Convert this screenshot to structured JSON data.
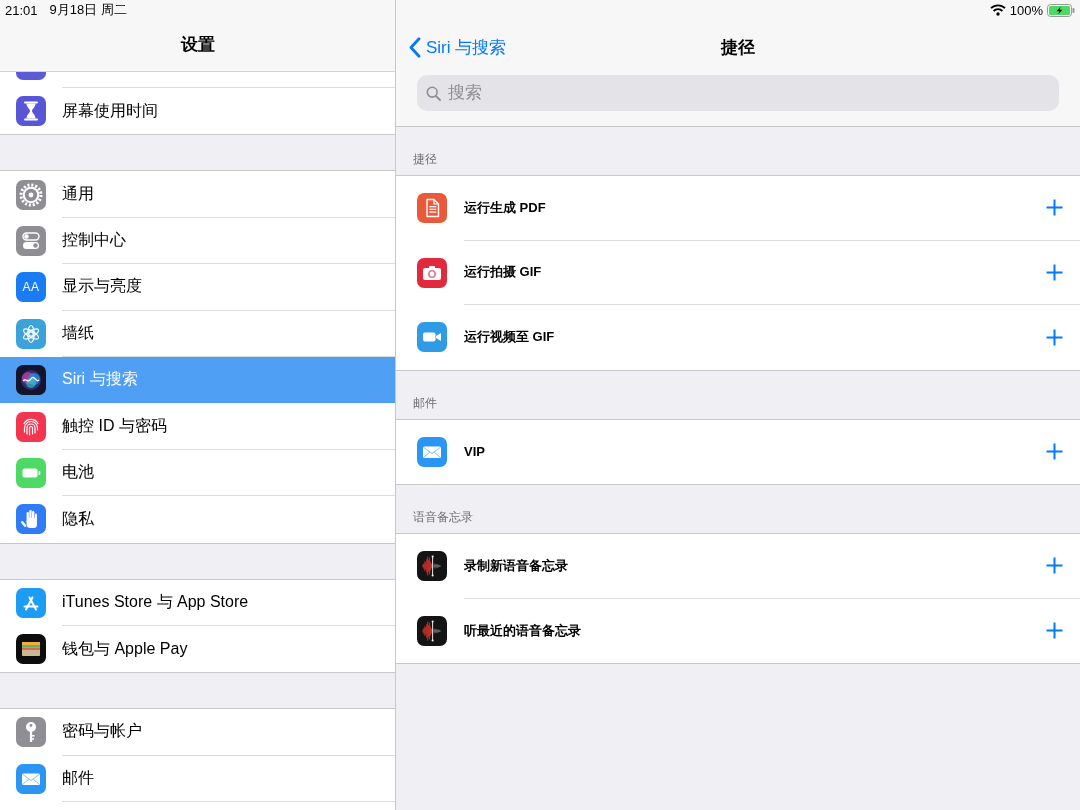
{
  "status_bar": {
    "time": "21:01",
    "date": "9月18日 周二",
    "battery": "100%",
    "charging": true
  },
  "sidebar": {
    "title": "设置",
    "groups": [
      {
        "items": [
          {
            "label": "屏幕使用时间",
            "selected": false
          }
        ]
      },
      {
        "items": [
          {
            "label": "通用",
            "selected": false
          },
          {
            "label": "控制中心",
            "selected": false
          },
          {
            "label": "显示与亮度",
            "selected": false,
            "icon_text": "AA"
          },
          {
            "label": "墙纸",
            "selected": false
          },
          {
            "label": "Siri 与搜索",
            "selected": true
          },
          {
            "label": "触控 ID 与密码",
            "selected": false
          },
          {
            "label": "电池",
            "selected": false
          },
          {
            "label": "隐私",
            "selected": false
          }
        ]
      },
      {
        "items": [
          {
            "label": "iTunes Store 与 App Store",
            "selected": false
          },
          {
            "label": "钱包与 Apple Pay",
            "selected": false
          }
        ]
      },
      {
        "items": [
          {
            "label": "密码与帐户",
            "selected": false
          },
          {
            "label": "邮件",
            "selected": false
          }
        ]
      }
    ]
  },
  "detail": {
    "back": "Siri 与搜索",
    "title": "捷径",
    "search": {
      "placeholder": "搜索"
    },
    "sections": [
      {
        "header": "捷径",
        "items": [
          {
            "label": "运行生成 PDF"
          },
          {
            "label": "运行拍摄 GIF"
          },
          {
            "label": "运行视频至 GIF"
          }
        ]
      },
      {
        "header": "邮件",
        "items": [
          {
            "label": "VIP"
          }
        ]
      },
      {
        "header": "语音备忘录",
        "items": [
          {
            "label": "录制新语音备忘录"
          },
          {
            "label": "听最近的语音备忘录"
          }
        ]
      }
    ]
  }
}
